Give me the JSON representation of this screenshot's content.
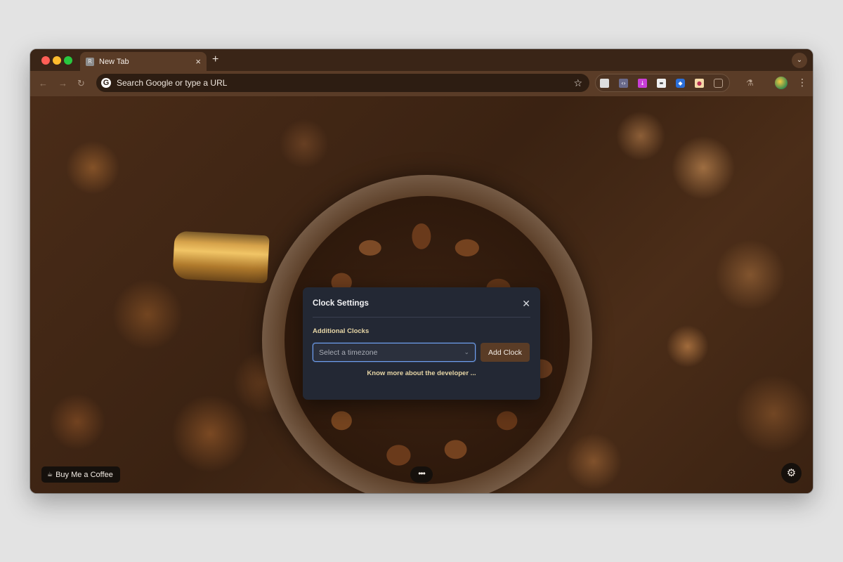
{
  "browser": {
    "tab": {
      "favicon_letter": "R",
      "title": "New Tab",
      "close": "×"
    },
    "new_tab": "+",
    "tab_search": "⌄",
    "nav": {
      "back": "←",
      "forward": "→",
      "reload": "↻"
    },
    "omnibox": {
      "logo": "G",
      "placeholder": "Search Google or type a URL",
      "star": "☆"
    },
    "extensions": [
      "file-icon",
      "code-icon",
      "download-icon",
      "tag-icon",
      "bookmark-icon",
      "image-icon",
      "puzzle-icon"
    ],
    "labs": "⚗",
    "menu": "⋮"
  },
  "dialog": {
    "title": "Clock Settings",
    "close": "✕",
    "section_label": "Additional Clocks",
    "timezone_select": {
      "placeholder": "Select a timezone",
      "chevron": "⌄"
    },
    "add_button": "Add Clock",
    "developer_link": "Know more about the developer ..."
  },
  "footer": {
    "buy_coffee": {
      "icon": "☕",
      "label": "Buy Me a Coffee"
    },
    "more": "•••",
    "settings": "⚙"
  },
  "colors": {
    "frame": "#3a2517",
    "toolbar": "#5a3c27",
    "dialog_bg": "#232834",
    "accent_text": "#e7d6a6",
    "focus_ring": "#6e9ff0"
  }
}
